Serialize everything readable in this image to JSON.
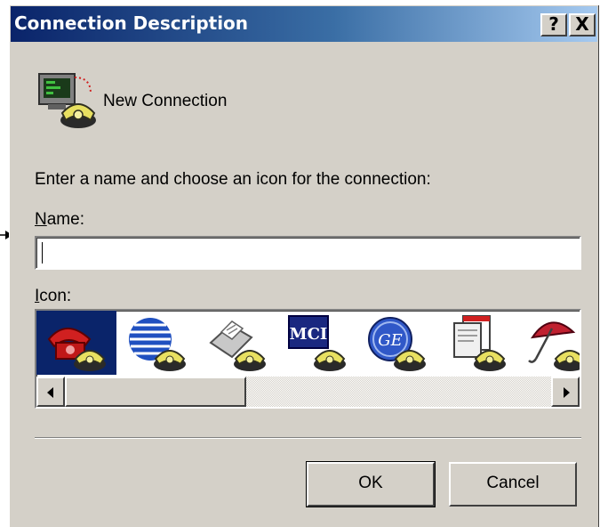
{
  "dialog": {
    "title": "Connection Description",
    "help_button": "?",
    "close_button": "X"
  },
  "connection": {
    "name": "New Connection"
  },
  "instructions": "Enter a name and choose an icon for the connection:",
  "name_field": {
    "label_accel": "N",
    "label_rest": "ame:",
    "value": ""
  },
  "icon_field": {
    "label_accel": "I",
    "label_rest": "con:",
    "icons": [
      {
        "icon": "red-phone-icon",
        "selected": true
      },
      {
        "icon": "globe-phone-icon",
        "selected": false
      },
      {
        "icon": "fax-phone-icon",
        "selected": false
      },
      {
        "icon": "mci-phone-icon",
        "text": "MCI",
        "selected": false
      },
      {
        "icon": "ge-phone-icon",
        "text": "GE",
        "selected": false
      },
      {
        "icon": "documents-phone-icon",
        "selected": false
      },
      {
        "icon": "umbrella-phone-icon",
        "selected": false
      }
    ]
  },
  "buttons": {
    "ok": "OK",
    "cancel": "Cancel"
  },
  "colors": {
    "title_gradient_start": "#0a246a",
    "title_gradient_end": "#a6caf0",
    "dialog_face": "#d4d0c8",
    "selection": "#0a246a"
  }
}
